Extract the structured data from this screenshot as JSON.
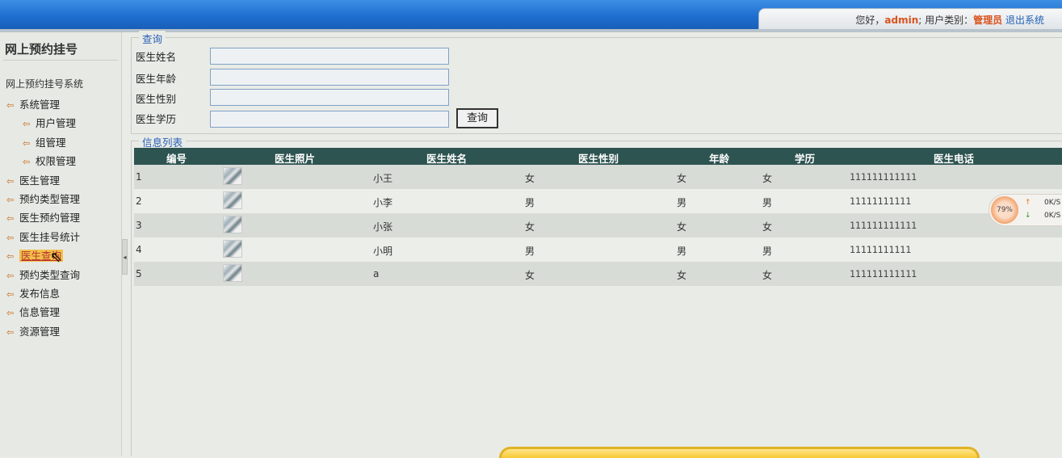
{
  "header": {
    "greeting": "您好，",
    "username": "admin",
    "sep": "; ",
    "role_label": "用户类别：",
    "role": "管理员",
    "logout": "退出系统"
  },
  "sidebar": {
    "title": "网上预约挂号",
    "subtitle": "网上预约挂号系统",
    "items": [
      {
        "label": "系统管理",
        "level": 0
      },
      {
        "label": "用户管理",
        "level": 1
      },
      {
        "label": "组管理",
        "level": 1
      },
      {
        "label": "权限管理",
        "level": 1
      },
      {
        "label": "医生管理",
        "level": 0
      },
      {
        "label": "预约类型管理",
        "level": 0
      },
      {
        "label": "医生预约管理",
        "level": 0
      },
      {
        "label": "医生挂号统计",
        "level": 0
      },
      {
        "label": "医生查询",
        "level": 0,
        "active": true
      },
      {
        "label": "预约类型查询",
        "level": 0
      },
      {
        "label": "发布信息",
        "level": 0
      },
      {
        "label": "信息管理",
        "level": 0
      },
      {
        "label": "资源管理",
        "level": 0
      }
    ]
  },
  "query": {
    "legend": "查询",
    "fields": [
      {
        "label": "医生姓名",
        "value": ""
      },
      {
        "label": "医生年龄",
        "value": ""
      },
      {
        "label": "医生性别",
        "value": ""
      },
      {
        "label": "医生学历",
        "value": ""
      }
    ],
    "button": "查询"
  },
  "list": {
    "legend": "信息列表",
    "columns": [
      "编号",
      "医生照片",
      "医生姓名",
      "医生性别",
      "年龄",
      "学历",
      "医生电话"
    ],
    "rows": [
      {
        "id": "1",
        "name": "小王",
        "gender": "女",
        "age": "女",
        "edu": "女",
        "phone": "111111111111"
      },
      {
        "id": "2",
        "name": "小李",
        "gender": "男",
        "age": "男",
        "edu": "男",
        "phone": "11111111111"
      },
      {
        "id": "3",
        "name": "小张",
        "gender": "女",
        "age": "女",
        "edu": "女",
        "phone": "111111111111"
      },
      {
        "id": "4",
        "name": "小明",
        "gender": "男",
        "age": "男",
        "edu": "男",
        "phone": "11111111111"
      },
      {
        "id": "5",
        "name": "a",
        "gender": "女",
        "age": "女",
        "edu": "女",
        "phone": "111111111111"
      }
    ]
  },
  "net_widget": {
    "percent": "79%",
    "up": "0K/S",
    "down": "0K/S"
  },
  "colors": {
    "header_blue": "#1e6fd0",
    "table_header": "#2e5451",
    "accent_orange": "#d9531e",
    "legend_blue": "#2a5fb8"
  }
}
